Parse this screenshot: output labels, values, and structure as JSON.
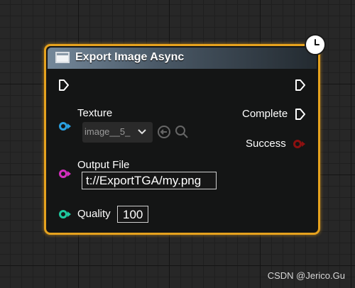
{
  "node": {
    "title": "Export Image Async",
    "inputs": {
      "texture": {
        "label": "Texture",
        "value": "image__5_"
      },
      "output_file": {
        "label": "Output File",
        "value": "t://ExportTGA/my.png"
      },
      "quality": {
        "label": "Quality",
        "value": "100"
      }
    },
    "outputs": {
      "complete": {
        "label": "Complete"
      },
      "success": {
        "label": "Success"
      }
    }
  },
  "colors": {
    "node_border": "#e6a21e",
    "pin_texture": "#2aa0e0",
    "pin_output_file": "#d42fbe",
    "pin_quality": "#1fc9a0",
    "pin_success": "#8c1010"
  },
  "icons": {
    "header": "image-icon",
    "badge": "clock-icon",
    "exec": "exec-pin-icon",
    "texture_buttons": [
      "use-selected-asset-icon",
      "browse-asset-icon"
    ]
  },
  "watermark": "CSDN @Jerico.Gu"
}
